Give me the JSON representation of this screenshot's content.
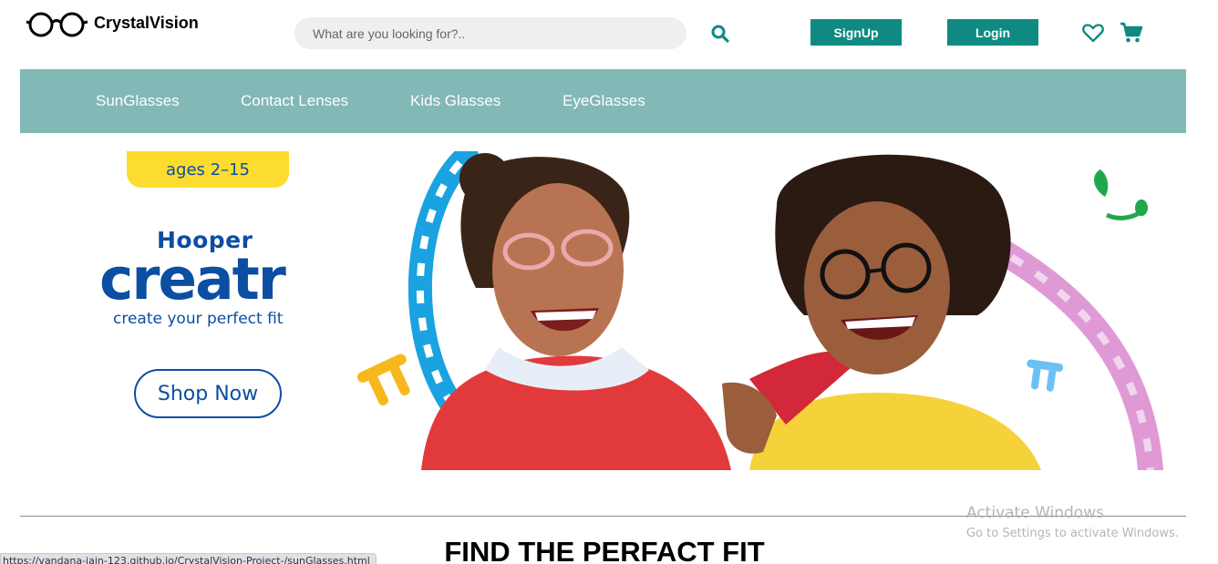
{
  "header": {
    "brand_name": "CrystalVision",
    "search": {
      "placeholder": "What are you looking for?..",
      "value": ""
    },
    "signup_label": "SignUp",
    "login_label": "Login",
    "icons": [
      "glasses-logo-icon",
      "search-icon",
      "heart-icon",
      "cart-icon"
    ]
  },
  "nav": {
    "items": [
      {
        "label": "SunGlasses"
      },
      {
        "label": "Contact Lenses"
      },
      {
        "label": "Kids Glasses"
      },
      {
        "label": "EyeGlasses"
      }
    ]
  },
  "banner": {
    "age_tag": "ages 2–15",
    "brand_top": "Hooper",
    "brand_main": "creatr",
    "tagline": "create your perfect fit",
    "cta_label": "Shop Now"
  },
  "section": {
    "title": "FIND THE PERFACT FIT"
  },
  "status_bar": {
    "url": "https://vandana-jain-123.github.io/CrystalVision-Project-/sunGlasses.html"
  },
  "watermark": {
    "line1": "Activate Windows",
    "line2": "Go to Settings to activate Windows."
  },
  "colors": {
    "accent": "#0e8a82",
    "nav_bg": "#82b8b6",
    "banner_blue": "#0b4ea2",
    "tag_yellow": "#fcdc2e"
  }
}
